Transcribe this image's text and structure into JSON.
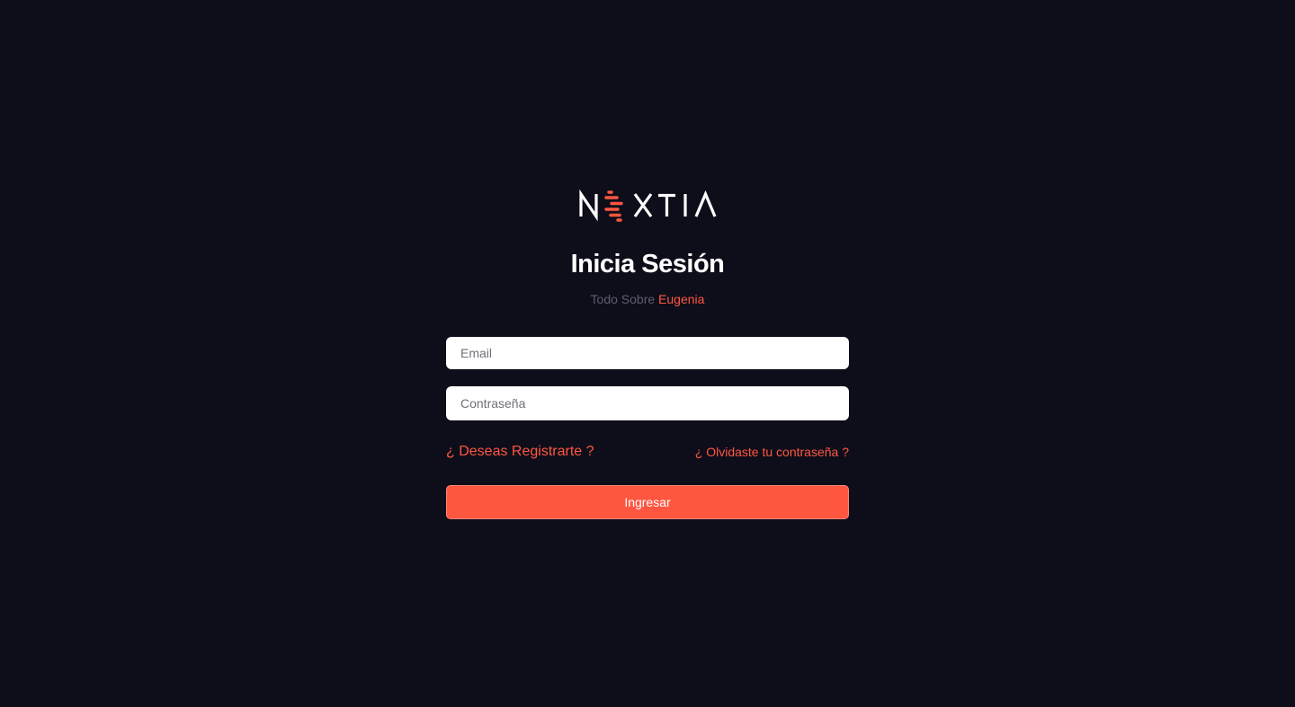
{
  "brand": {
    "logo_text": "NEXTIA",
    "logo_icon": "nextia-logo",
    "accent_color": "#ff5640",
    "text_color": "#ffffff"
  },
  "login": {
    "title": "Inicia Sesión",
    "subtitle_prefix": "Todo Sobre",
    "subtitle_accent": "Eugenia",
    "email_placeholder": "Email",
    "password_placeholder": "Contraseña",
    "register_link": "¿ Deseas Registrarte ?",
    "forgot_link": "¿ Olvidaste tu contraseña ?",
    "submit_label": "Ingresar"
  },
  "colors": {
    "background": "#0e0e1a",
    "accent": "#ff5640",
    "muted_text": "#5d5f6f"
  }
}
